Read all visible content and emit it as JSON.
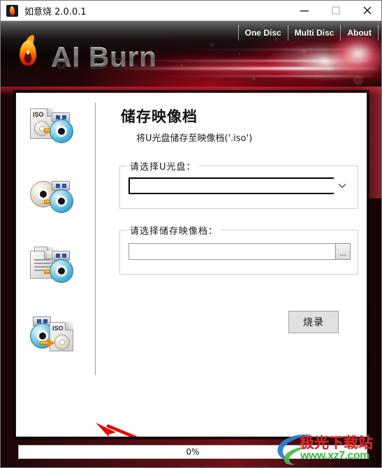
{
  "window": {
    "title": "如意烧 2.0.0.1",
    "app_icon": "flame-icon",
    "controls": {
      "minimize": "minimize-icon",
      "maximize": "maximize-icon",
      "close": "close-icon"
    }
  },
  "banner": {
    "logo_text": "AI Burn",
    "logo_icon": "flame-logo-icon",
    "nav": [
      {
        "label": "One Disc"
      },
      {
        "label": "Multi Disc"
      },
      {
        "label": "About"
      }
    ]
  },
  "sidebar": {
    "items": [
      {
        "name": "burn-iso-to-disc",
        "icon": "iso-file-to-disc-icon",
        "selected": false
      },
      {
        "name": "copy-disc",
        "icon": "disc-to-disc-icon",
        "selected": false
      },
      {
        "name": "burn-files-to-disc",
        "icon": "files-to-disc-icon",
        "selected": false
      },
      {
        "name": "save-disc-to-iso",
        "icon": "disc-to-iso-file-icon",
        "selected": true
      }
    ]
  },
  "main": {
    "title": "储存映像档",
    "subtitle": "将U光盘储存至映像档('.iso')",
    "drive_group": {
      "legend": "请选择U光盘：",
      "combo_value": "",
      "dropdown_icon": "chevron-down-icon"
    },
    "image_group": {
      "legend": "请选择储存映像档：",
      "path_value": "",
      "browse_label": "..."
    },
    "burn_button": "烧录"
  },
  "status": {
    "progress_label": "0%",
    "progress_percent": 0
  },
  "annotation": {
    "arrow": "red-arrow-pointer"
  },
  "watermark": {
    "site_name": "极光下载站",
    "url": "www.xz7.com"
  },
  "colors": {
    "accent_red": "#c8102e",
    "banner_dark": "#140406",
    "panel_bg": "#ffffff",
    "watermark_red": "#e01f1f",
    "watermark_green": "#3fb53f",
    "arrow_red": "#ef0000"
  }
}
